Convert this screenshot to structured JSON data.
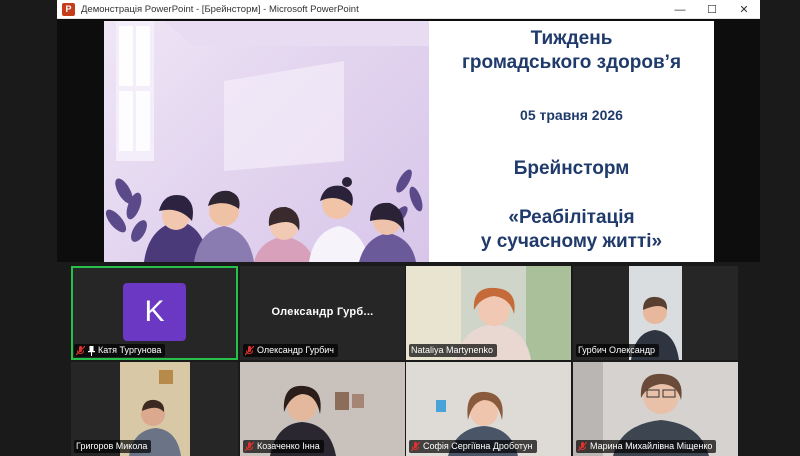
{
  "window": {
    "app_icon": "powerpoint-icon",
    "title": "Демонстрація PowerPoint - [Брейнсторм] - Microsoft PowerPoint",
    "minimize": "—",
    "maximize": "☐",
    "close": "✕"
  },
  "slide": {
    "title_line1": "Тиждень",
    "title_line2": "громадського здоров’я",
    "date": "05 травня 2026",
    "heading": "Брейнсторм",
    "topic_line1": "«Реабілітація",
    "topic_line2": "у сучасному житті»",
    "title_color": "#1f3a6b"
  },
  "participants": [
    {
      "name": "Катя Тургунова",
      "avatar_letter": "K",
      "muted": true,
      "pinned": true,
      "active_speaker": true
    },
    {
      "name": "Олександр Гурбич",
      "display_name": "Олександр  Гурб...",
      "muted": true
    },
    {
      "name": "Nataliya Martynenko",
      "muted": false
    },
    {
      "name": "Гурбич Олександр",
      "muted": false
    },
    {
      "name": "Григоров Микола",
      "muted": false
    },
    {
      "name": "Козаченко Інна",
      "muted": true
    },
    {
      "name": "Софія Сергіївна Дроботун",
      "muted": true
    },
    {
      "name": "Марина Михайлівна Міщенко",
      "muted": true
    }
  ],
  "colors": {
    "active_border": "#27c04a",
    "avatar_bg": "#6a38c2",
    "muted_icon": "#e0312e"
  }
}
